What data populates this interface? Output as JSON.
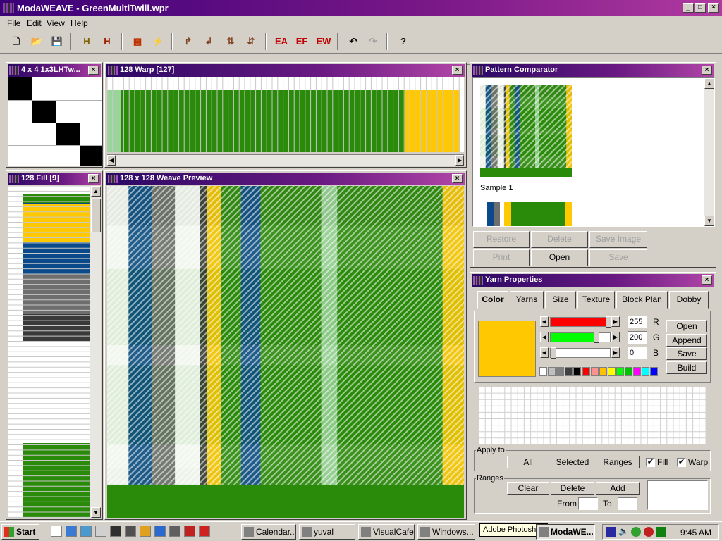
{
  "app": {
    "title": "ModaWEAVE - GreenMultiTwill.wpr"
  },
  "window_controls": {
    "min": "_",
    "max": "□",
    "close": "×"
  },
  "menu": {
    "items": [
      {
        "label": "File",
        "name": "menu-file"
      },
      {
        "label": "Edit",
        "name": "menu-edit"
      },
      {
        "label": "View",
        "name": "menu-view"
      },
      {
        "label": "Help",
        "name": "menu-help"
      }
    ]
  },
  "toolbar": {
    "buttons": [
      {
        "name": "new-icon",
        "glyph": "🗋",
        "color": "#000000"
      },
      {
        "name": "open-icon",
        "glyph": "📂",
        "color": "#c08000"
      },
      {
        "name": "save-icon",
        "glyph": "💾",
        "color": "#000080"
      },
      {
        "name": "harness-icon",
        "glyph": "H",
        "color": "#806000"
      },
      {
        "name": "harness-alt-icon",
        "glyph": "H",
        "color": "#a02000"
      },
      {
        "name": "pattern-fill-icon",
        "glyph": "▦",
        "color": "#c03000"
      },
      {
        "name": "lightning-icon",
        "glyph": "⚡",
        "color": "#d08000"
      },
      {
        "name": "rotate-right-icon",
        "glyph": "↱",
        "color": "#804020"
      },
      {
        "name": "rotate-left-icon",
        "glyph": "↲",
        "color": "#804020"
      },
      {
        "name": "flip-vertical-icon",
        "glyph": "⇅",
        "color": "#804020"
      },
      {
        "name": "flip-horizontal-icon",
        "glyph": "⇵",
        "color": "#804020"
      },
      {
        "name": "edit-warp-icon",
        "glyph": "EA",
        "color": "#c00000"
      },
      {
        "name": "edit-fill-icon",
        "glyph": "EF",
        "color": "#c00000"
      },
      {
        "name": "edit-weave-icon",
        "glyph": "EW",
        "color": "#c00000"
      },
      {
        "name": "undo-icon",
        "glyph": "↶",
        "color": "#000000"
      },
      {
        "name": "redo-icon",
        "glyph": "↷",
        "color": "#a0a0a0"
      },
      {
        "name": "help-icon",
        "glyph": "?",
        "color": "#000000"
      }
    ]
  },
  "weave_window": {
    "title": "4 x 4 1x3LHTw..."
  },
  "warp_window": {
    "title": "128 Warp  [127]"
  },
  "fill_window": {
    "title": "128 Fill  [9]"
  },
  "preview_window": {
    "title": "128 x 128 Weave Preview"
  },
  "comparator": {
    "title": "Pattern Comparator",
    "sample_label": "Sample 1",
    "buttons": {
      "restore": "Restore",
      "delete": "Delete",
      "save_image": "Save Image",
      "print": "Print",
      "open": "Open",
      "save": "Save"
    }
  },
  "yarn": {
    "title": "Yarn Properties",
    "tabs": [
      "Color",
      "Yarns",
      "Size",
      "Texture",
      "Block Plan",
      "Dobby"
    ],
    "active_tab": "Color",
    "swatch_color": "#ffc800",
    "channels": [
      {
        "label": "R",
        "value": "255",
        "color": "#ff0000",
        "fraction": 1.0
      },
      {
        "label": "G",
        "value": "200",
        "color": "#00ff00",
        "fraction": 0.784
      },
      {
        "label": "B",
        "value": "0",
        "color": "#0000ff",
        "fraction": 0.0
      }
    ],
    "side_buttons": {
      "open": "Open",
      "append": "Append",
      "save": "Save",
      "build": "Build"
    },
    "palette": [
      "#ffffff",
      "#c0c0c0",
      "#808080",
      "#404040",
      "#000000",
      "#ff0000",
      "#ff9090",
      "#ffc000",
      "#ffff00",
      "#00ff00",
      "#00c000",
      "#ff00ff",
      "#00ffff",
      "#0000ff"
    ],
    "apply_to": {
      "label": "Apply to",
      "all": "All",
      "selected": "Selected",
      "ranges": "Ranges",
      "fill": {
        "label": "Fill",
        "checked": "✔"
      },
      "warp": {
        "label": "Warp",
        "checked": "✔"
      }
    },
    "ranges": {
      "label": "Ranges",
      "clear": "Clear",
      "delete": "Delete",
      "add": "Add",
      "from_label": "From",
      "to_label": "To",
      "from_value": "",
      "to_value": ""
    }
  },
  "colors": {
    "green": "#2a8a0a",
    "light_green": "#9ad49a",
    "yellow": "#ffc800",
    "blue": "#0a4a8a",
    "gray": "#6e6e6e",
    "dark_gray": "#3a3a3a",
    "white": "#ffffff"
  },
  "taskbar": {
    "start": "Start",
    "quicklaunch": [
      "desktop-icon",
      "monitor-icon",
      "network-icon",
      "mouse-icon",
      "screen-icon",
      "terminal-icon",
      "refresh-icon",
      "ie-icon",
      "window-icon",
      "flag-icon",
      "acrobat-icon"
    ],
    "tasks": [
      {
        "label": "Calendar...",
        "name": "task-calendar"
      },
      {
        "label": "yuval",
        "name": "task-yuval"
      },
      {
        "label": "VisualCafe",
        "name": "task-visualcafe"
      },
      {
        "label": "Windows...",
        "name": "task-windows"
      },
      {
        "label": "ModaWE...",
        "name": "task-modaweave"
      }
    ],
    "tooltip": "Adobe Photoshop",
    "clock": "9:45 AM"
  }
}
